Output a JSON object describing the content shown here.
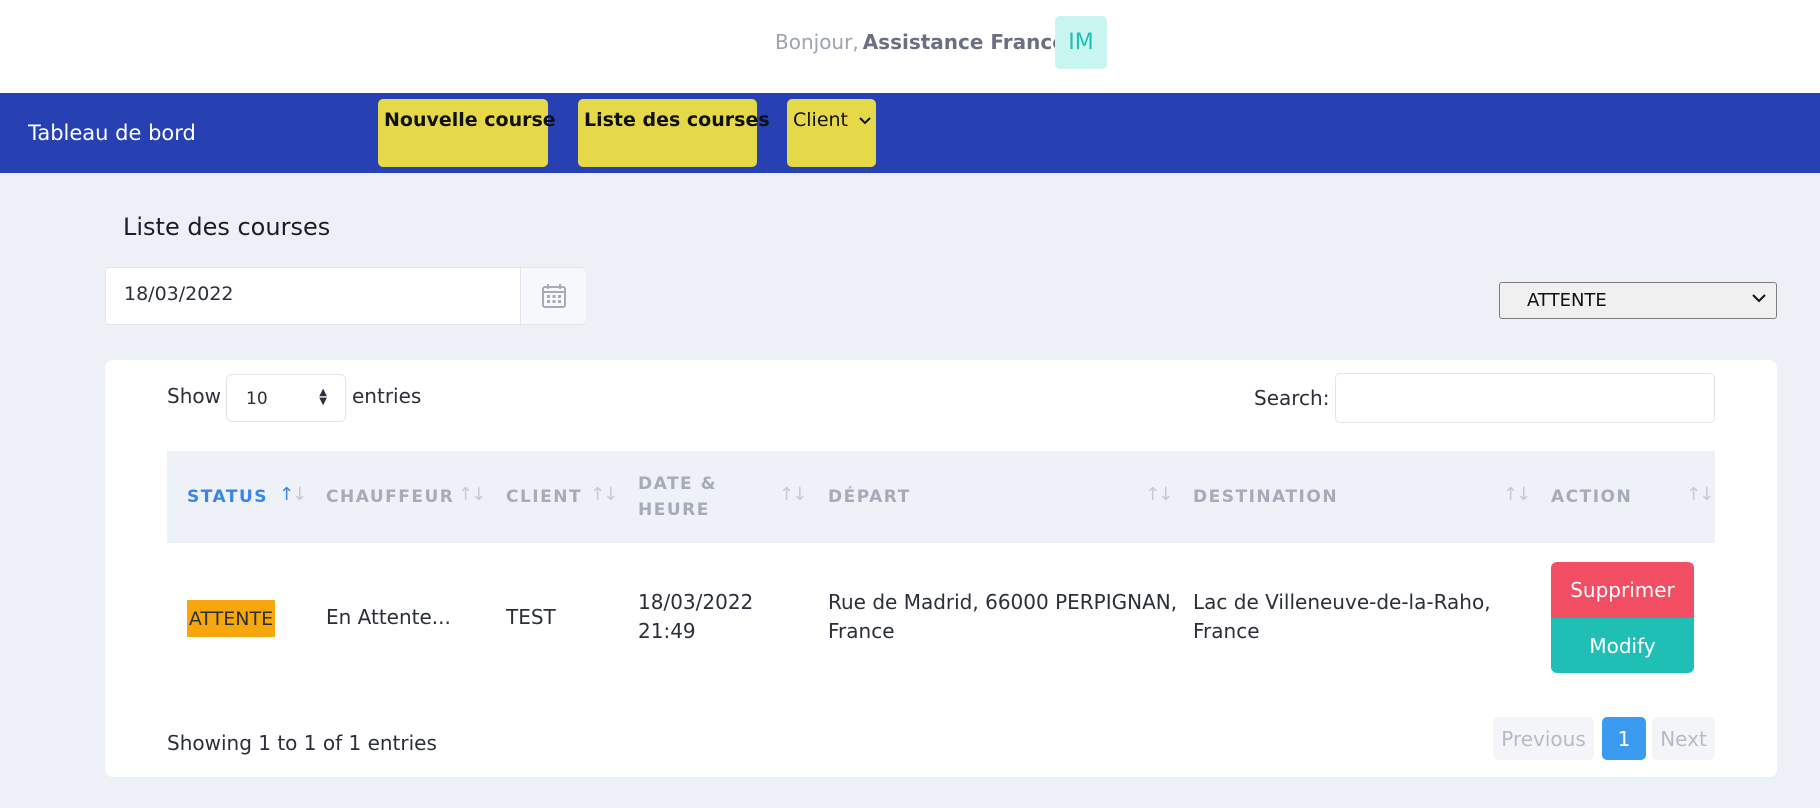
{
  "header": {
    "greeting": "Bonjour,",
    "user_name": "Assistance France",
    "avatar_initials": "IM"
  },
  "navbar": {
    "brand": "Tableau de bord",
    "items": [
      {
        "label": "Nouvelle course"
      },
      {
        "label": "Liste des courses"
      },
      {
        "label": "Client"
      }
    ]
  },
  "page": {
    "title": "Liste des courses",
    "date_value": "18/03/2022",
    "status_filter": "ATTENTE"
  },
  "table_controls": {
    "show_label": "Show",
    "page_length": "10",
    "entries_label": "entries",
    "search_label": "Search:",
    "search_value": ""
  },
  "table": {
    "columns": [
      {
        "label": "STATUS"
      },
      {
        "label": "CHAUFFEUR"
      },
      {
        "label": "CLIENT"
      },
      {
        "label": "DATE &",
        "label2": "HEURE"
      },
      {
        "label": "DÉPART"
      },
      {
        "label": "DESTINATION"
      },
      {
        "label": "ACTION"
      }
    ],
    "sorted_column": "STATUS",
    "rows": [
      {
        "status": "ATTENTE",
        "chauffeur": "En Attente...",
        "client": "TEST",
        "date": "18/03/2022",
        "heure": "21:49",
        "depart_line1": "Rue de Madrid, 66000 PERPIGNAN,",
        "depart_line2": "France",
        "destination_line1": "Lac de Villeneuve-de-la-Raho,",
        "destination_line2": "France",
        "delete_label": "Supprimer",
        "modify_label": "Modify"
      }
    ]
  },
  "footer": {
    "info": "Showing 1 to 1 of 1 entries",
    "previous_label": "Previous",
    "current_page": "1",
    "next_label": "Next"
  },
  "colors": {
    "navbar": "#2741b2",
    "nav_button": "#e5d94a",
    "status_badge": "#f7a70c",
    "delete_button": "#f14e63",
    "modify_button": "#1fbfb5",
    "active_page": "#3a9bf0"
  }
}
